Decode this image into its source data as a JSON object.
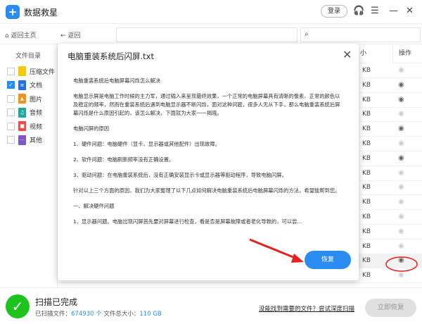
{
  "app": {
    "title": "数据救星",
    "login": "登录"
  },
  "nav": {
    "home": "返回主页",
    "back": "返回"
  },
  "sidebar": {
    "header": "文件目录",
    "items": [
      {
        "label": "压缩文件",
        "checked": false,
        "color": "#f5c518"
      },
      {
        "label": "文档",
        "checked": true,
        "color": "#2a6fd6"
      },
      {
        "label": "图片",
        "checked": false,
        "color": "#f5921e"
      },
      {
        "label": "音频",
        "checked": false,
        "color": "#26a69a"
      },
      {
        "label": "视频",
        "checked": false,
        "color": "#e84c4c"
      },
      {
        "label": "其他",
        "checked": false,
        "color": "#7e57c2"
      }
    ]
  },
  "columns": {
    "size": "大小",
    "action": "操作"
  },
  "rows": [
    {
      "size": "KB",
      "preview": false
    },
    {
      "size": "KB",
      "preview": true
    },
    {
      "size": "KB",
      "preview": true
    },
    {
      "size": "KB",
      "preview": false
    },
    {
      "size": "KB",
      "preview": true
    },
    {
      "size": "KB",
      "preview": false
    },
    {
      "size": "KB",
      "preview": true
    },
    {
      "size": "KB",
      "preview": false
    },
    {
      "size": "KB",
      "preview": false
    },
    {
      "size": "KB",
      "preview": false
    },
    {
      "size": "KB",
      "preview": false
    },
    {
      "size": "KB",
      "preview": false
    },
    {
      "size": "KB",
      "preview": false
    },
    {
      "size": "KB",
      "preview": true,
      "highlighted": true
    },
    {
      "size": "KB",
      "preview": false
    }
  ],
  "dialog": {
    "title": "电脑重装系统后闪屏.txt",
    "restore": "恢复",
    "paragraphs": [
      "电脑重装系统后电脑屏幕闪烁怎么解决",
      "电脑显示屏是电脑工作时候的主力军，通过输入来呈现最终效果，一个正常的电脑屏幕具有清晰的像素、正常的颜色以及稳定的频率，然而在重装系统后遇到电脑显示器不断闪烁，面对这种问题，很多人无从下手，那么电脑重装系统后屏幕闪烁是什么原因引起的，该怎么解决，下面就为大家一一揭晓。",
      "电脑闪屏的原因",
      "1、硬件问题：电脑硬件（显卡、显示器或其他配件）出现故障。",
      "2、软件问题：电脑刷新频率没有正确设置。",
      "3、驱动问题：在电脑重装系统后，没有正确安装显示卡或显示器等驱动程序，导致电脑闪屏。",
      "针对以上三个方面的原因，我们为大家整理了以下几点如何解决电脑重装系统后电脑屏幕闪烁的方法，希望能帮到您。",
      "一、解决硬件问题",
      "1、显示器问题。电脑出现闪屏首先要对屏幕进行检查，看是否是屏幕故障或者老化导致的，可以尝..."
    ]
  },
  "footer": {
    "status": "扫描已完成",
    "scanned_label": "已扫描文件：",
    "scanned_value": "674930 个",
    "size_label": "文件总大小：",
    "size_value": "110 GB",
    "deep_scan": "没能找到需要的文件？尝试深度扫描",
    "recover": "立即恢复"
  }
}
